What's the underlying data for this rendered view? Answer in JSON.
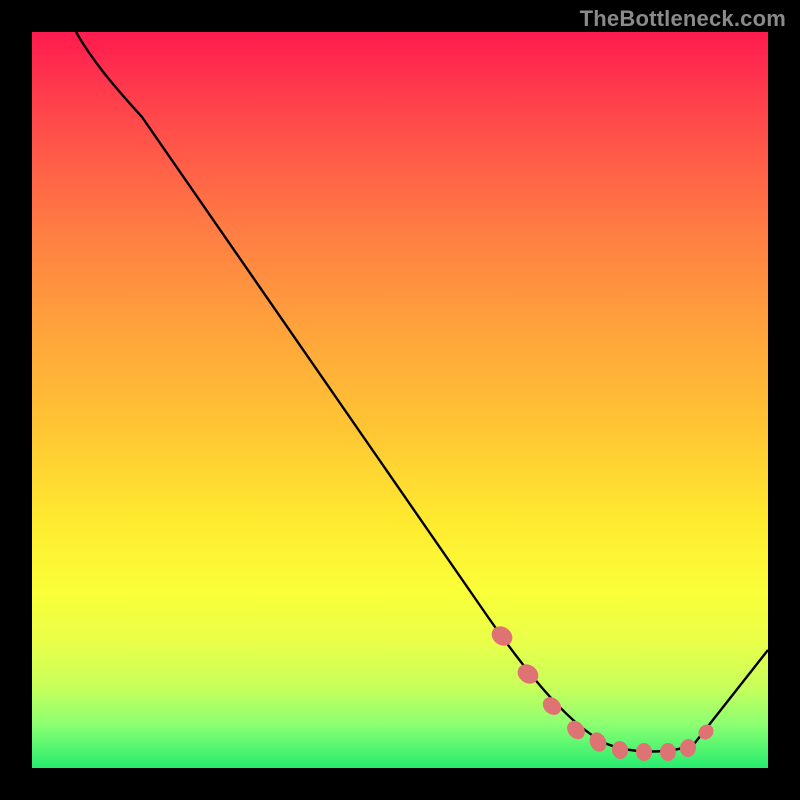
{
  "watermark": "TheBottleneck.com",
  "chart_data": {
    "type": "line",
    "title": "",
    "xlabel": "",
    "ylabel": "",
    "xlim": [
      0,
      100
    ],
    "ylim": [
      0,
      100
    ],
    "grid": false,
    "legend": false,
    "series": [
      {
        "name": "curve",
        "type": "line",
        "color": "#000000",
        "x": [
          6,
          10,
          15,
          20,
          25,
          30,
          35,
          40,
          45,
          50,
          55,
          60,
          62,
          65,
          70,
          75,
          80,
          82,
          85,
          90,
          95,
          100
        ],
        "y": [
          100,
          96,
          92,
          85,
          78,
          71,
          64,
          57,
          50,
          43,
          36,
          29,
          25,
          20,
          13,
          8,
          4,
          3,
          3,
          3,
          8,
          16
        ]
      },
      {
        "name": "markers",
        "type": "scatter",
        "color": "#e07070",
        "x": [
          62,
          65,
          70,
          72,
          75,
          78,
          80,
          82,
          85,
          87
        ],
        "y": [
          25,
          20,
          13,
          10,
          8,
          5,
          4,
          3,
          3,
          3
        ]
      }
    ],
    "background_gradient": {
      "top": "#ff1b4f",
      "mid": "#ffe930",
      "bottom": "#26ec6f"
    }
  }
}
